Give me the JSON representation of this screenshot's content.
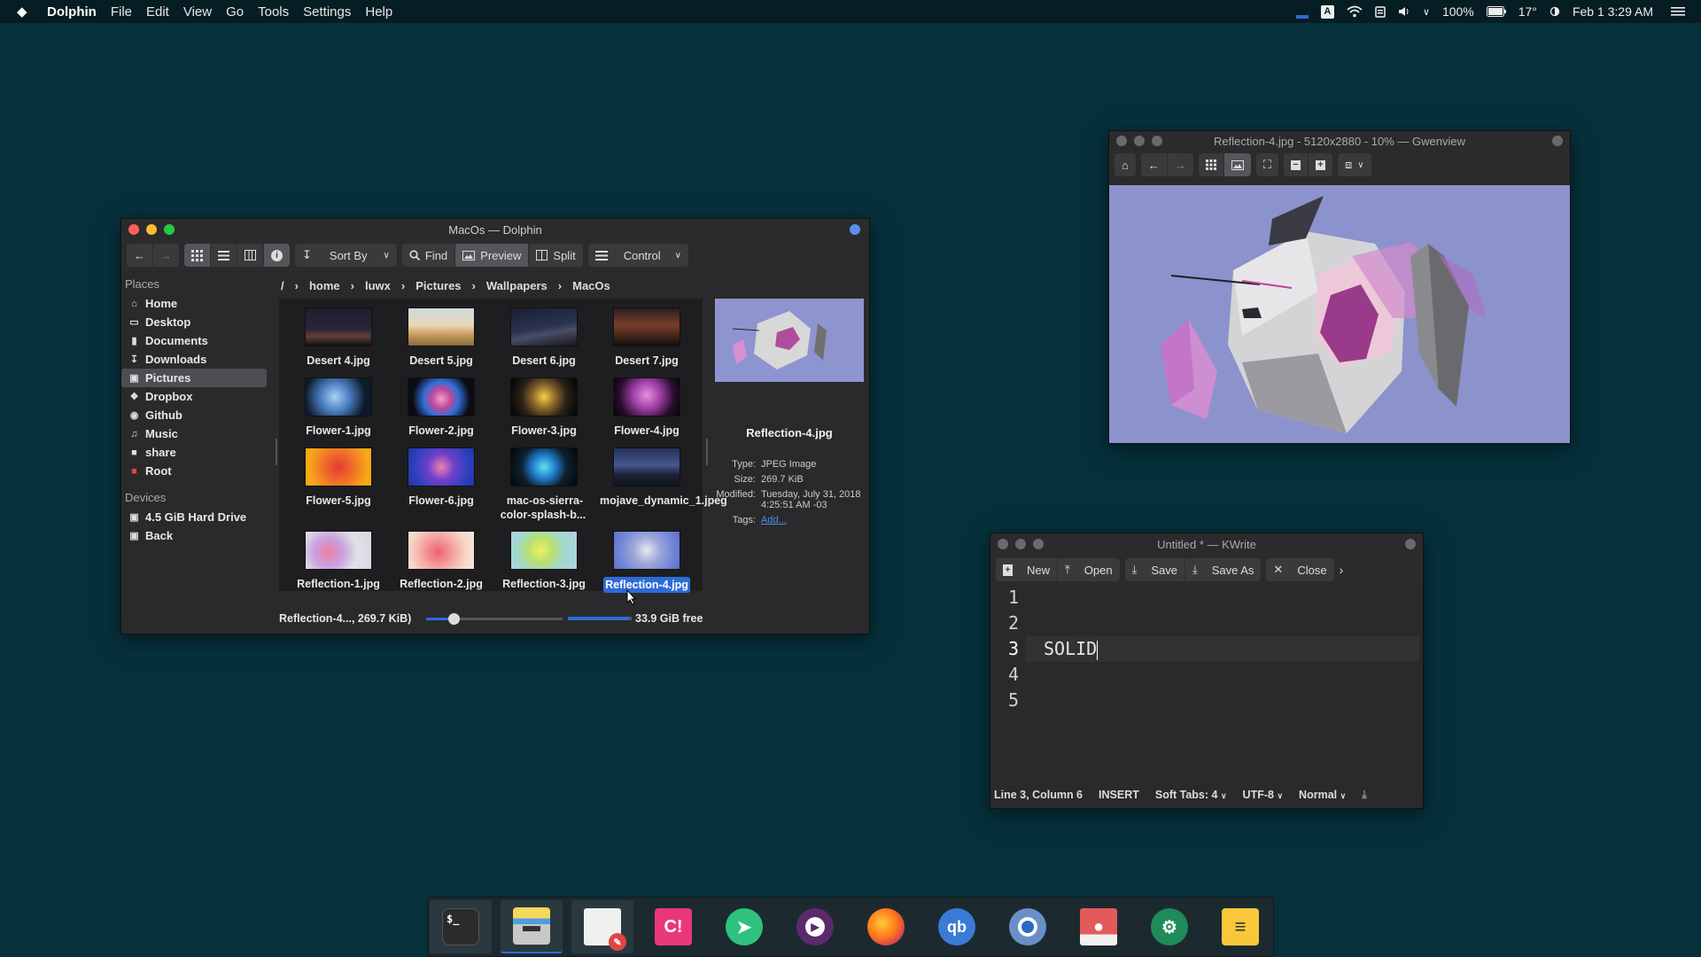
{
  "menubar": {
    "app_name": "Dolphin",
    "menus": [
      "File",
      "Edit",
      "View",
      "Go",
      "Tools",
      "Settings",
      "Help"
    ],
    "battery": "100%",
    "temperature": "17°",
    "clock": "Feb 1  3:29 AM"
  },
  "dolphin": {
    "title": "MacOs — Dolphin",
    "toolbar": {
      "sort_label": "Sort By",
      "find_label": "Find",
      "preview_label": "Preview",
      "split_label": "Split",
      "control_label": "Control"
    },
    "places_header": "Places",
    "places": [
      "Home",
      "Desktop",
      "Documents",
      "Downloads",
      "Pictures",
      "Dropbox",
      "Github",
      "Music",
      "share",
      "Root"
    ],
    "devices_header": "Devices",
    "devices": [
      "4.5 GiB Hard Drive",
      "Back"
    ],
    "breadcrumb": [
      "/",
      "home",
      "luwx",
      "Pictures",
      "Wallpapers",
      "MacOs"
    ],
    "files": [
      {
        "name": "Desert 4.jpg"
      },
      {
        "name": "Desert 5.jpg"
      },
      {
        "name": "Desert 6.jpg"
      },
      {
        "name": "Desert 7.jpg"
      },
      {
        "name": "Flower-1.jpg"
      },
      {
        "name": "Flower-2.jpg"
      },
      {
        "name": "Flower-3.jpg"
      },
      {
        "name": "Flower-4.jpg"
      },
      {
        "name": "Flower-5.jpg"
      },
      {
        "name": "Flower-6.jpg"
      },
      {
        "name": "mac-os-sierra-color-splash-b..."
      },
      {
        "name": "mojave_dynamic_1.jpeg"
      },
      {
        "name": "Reflection-1.jpg"
      },
      {
        "name": "Reflection-2.jpg"
      },
      {
        "name": "Reflection-3.jpg"
      },
      {
        "name": "Reflection-4.jpg"
      }
    ],
    "selected_file": "Reflection-4.jpg",
    "info": {
      "name": "Reflection-4.jpg",
      "type_label": "Type:",
      "type": "JPEG Image",
      "size_label": "Size:",
      "size": "269.7 KiB",
      "modified_label": "Modified:",
      "modified": "Tuesday, July 31, 2018 4:25:51 AM -03",
      "tags_label": "Tags:",
      "tags_link": "Add..."
    },
    "status_text": "Reflection-4..., 269.7 KiB)",
    "free_space": "33.9 GiB free",
    "zoom_level": 0.2,
    "disk_used_fraction": 0.96
  },
  "gwenview": {
    "title": "Reflection-4.jpg - 5120x2880 - 10% — Gwenview"
  },
  "kwrite": {
    "title": "Untitled * — KWrite",
    "toolbar": {
      "new": "New",
      "open": "Open",
      "save": "Save",
      "save_as": "Save As",
      "close": "Close"
    },
    "line_numbers": [
      "1",
      "2",
      "3",
      "4",
      "5"
    ],
    "lines": [
      "",
      "",
      "SOLID",
      "",
      ""
    ],
    "status": {
      "position": "Line 3, Column 6",
      "mode": "INSERT",
      "tabs": "Soft Tabs: 4",
      "encoding": "UTF-8",
      "syntax": "Normal"
    }
  },
  "colors": {
    "desktop": "#06313c",
    "selection": "#2e6bd8",
    "accent_red": "#ff5f57",
    "accent_yellow": "#febc2e",
    "accent_green": "#28c840"
  },
  "dock": [
    "terminal-icon",
    "files-icon",
    "text-editor-icon",
    "clipboard-icon",
    "telegram-icon",
    "media-player-icon",
    "firefox-icon",
    "qbittorrent-icon",
    "chromium-icon",
    "image-viewer-icon",
    "settings-icon",
    "notes-icon"
  ]
}
